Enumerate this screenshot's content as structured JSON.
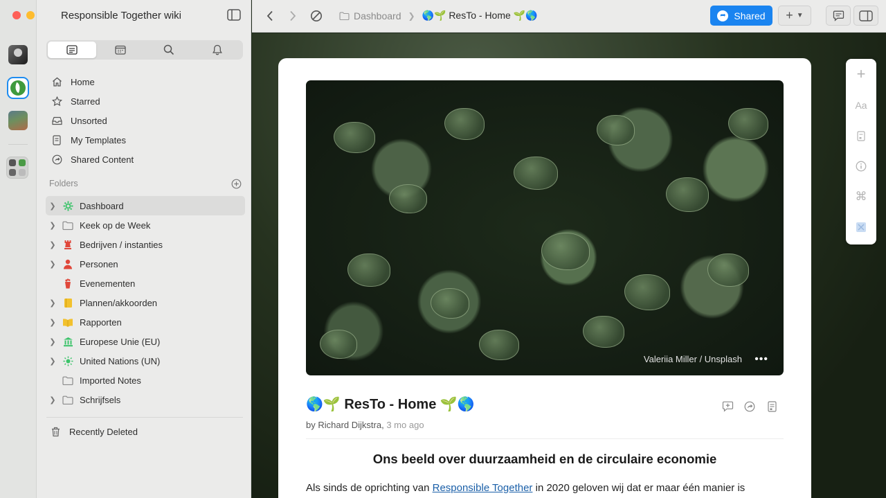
{
  "window": {
    "title": "Responsible Together wiki"
  },
  "spaces": [
    {
      "name": "space-1-icon"
    },
    {
      "name": "space-2-icon"
    },
    {
      "name": "space-3-icon"
    },
    {
      "name": "space-4-icon"
    }
  ],
  "sidebar": {
    "tabs": [
      "notes-icon",
      "calendar-icon",
      "search-icon",
      "bell-icon"
    ],
    "nav": [
      {
        "label": "Home",
        "icon": "home-icon"
      },
      {
        "label": "Starred",
        "icon": "star-icon"
      },
      {
        "label": "Unsorted",
        "icon": "inbox-icon"
      },
      {
        "label": "My Templates",
        "icon": "template-icon"
      },
      {
        "label": "Shared Content",
        "icon": "share-icon"
      }
    ],
    "folders_label": "Folders",
    "folders": [
      {
        "label": "Dashboard",
        "icon": "gear-icon",
        "color": "#3cc36a"
      },
      {
        "label": "Keek op de Week",
        "icon": "folder-icon",
        "color": "#8a8a8a"
      },
      {
        "label": "Bedrijven / instanties",
        "icon": "chess-rook-icon",
        "color": "#e0473a"
      },
      {
        "label": "Personen",
        "icon": "person-icon",
        "color": "#e0473a"
      },
      {
        "label": "Evenementen",
        "icon": "party-icon",
        "color": "#e0473a"
      },
      {
        "label": "Plannen/akkoorden",
        "icon": "notebook-icon",
        "color": "#f2c12e"
      },
      {
        "label": "Rapporten",
        "icon": "book-icon",
        "color": "#f2c12e"
      },
      {
        "label": "Europese Unie (EU)",
        "icon": "bank-icon",
        "color": "#3cc36a"
      },
      {
        "label": "United Nations (UN)",
        "icon": "sun-icon",
        "color": "#3cc36a"
      },
      {
        "label": "Imported Notes",
        "icon": "folder-icon",
        "color": "#8a8a8a"
      },
      {
        "label": "Schrijfsels",
        "icon": "folder-icon",
        "color": "#8a8a8a"
      }
    ],
    "recently_deleted": "Recently Deleted"
  },
  "toolbar": {
    "breadcrumb_parent": "Dashboard",
    "breadcrumb_current": "🌎🌱 ResTo - Home 🌱🌎",
    "shared_label": "Shared"
  },
  "document": {
    "cover_credit": "Valeriia Miller / Unsplash",
    "title": "🌎🌱 ResTo - Home 🌱🌎",
    "by_prefix": "by",
    "author": "Richard Dijkstra",
    "age": "3 mo ago",
    "heading": "Ons beeld over duurzaamheid en de circulaire economie",
    "para_start": "Als sinds de oprichting van",
    "para_link": "Responsible Together",
    "para_end": "in 2020 geloven wij dat er maar één manier is"
  },
  "right_toolbar": [
    "plus-icon",
    "font-icon",
    "document-icon",
    "info-icon",
    "command-icon",
    "mini-cover-icon"
  ],
  "right_toolbar_font_label": "Aa",
  "colors": {
    "accent": "#1a84f0",
    "sidebar_bg": "#ebebea"
  }
}
